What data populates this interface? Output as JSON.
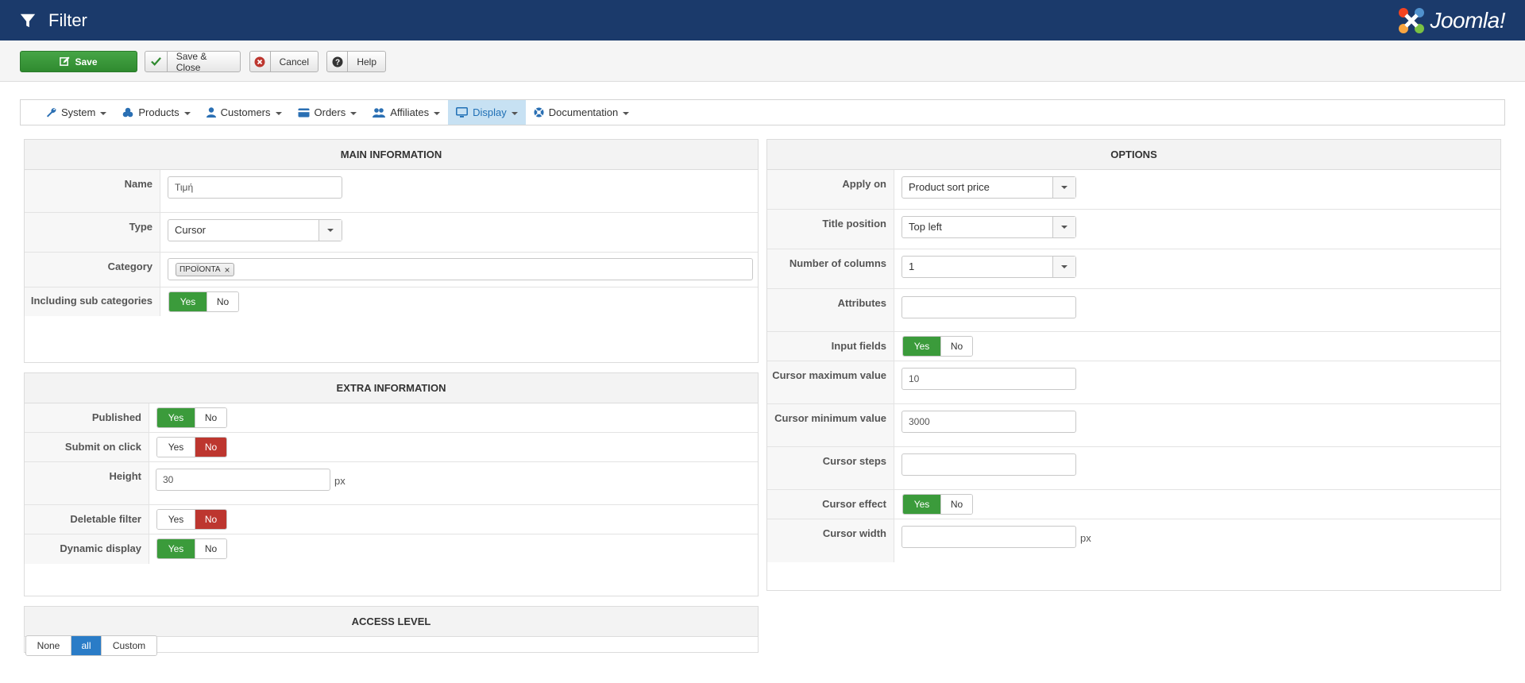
{
  "header": {
    "title": "Filter",
    "logo_text": "Joomla!"
  },
  "toolbar": {
    "save": "Save",
    "save_close": "Save & Close",
    "cancel": "Cancel",
    "help": "Help"
  },
  "menu": {
    "items": [
      {
        "label": "System",
        "icon": "wrench-icon"
      },
      {
        "label": "Products",
        "icon": "cubes-icon"
      },
      {
        "label": "Customers",
        "icon": "user-icon"
      },
      {
        "label": "Orders",
        "icon": "credit-card-icon"
      },
      {
        "label": "Affiliates",
        "icon": "users-icon"
      },
      {
        "label": "Display",
        "icon": "monitor-icon",
        "active": true
      },
      {
        "label": "Documentation",
        "icon": "lifebuoy-icon"
      }
    ]
  },
  "main_info": {
    "heading": "MAIN INFORMATION",
    "name_label": "Name",
    "name_value": "Τιμή",
    "type_label": "Type",
    "type_value": "Cursor",
    "category_label": "Category",
    "category_tag": "ΠΡΟΪΟΝΤΑ",
    "sub_label": "Including sub categories",
    "yes": "Yes",
    "no": "No",
    "sub_value": "Yes"
  },
  "extra_info": {
    "heading": "EXTRA INFORMATION",
    "published_label": "Published",
    "published_value": "Yes",
    "submit_label": "Submit on click",
    "submit_value": "No",
    "height_label": "Height",
    "height_value": "30",
    "height_unit": "px",
    "deletable_label": "Deletable filter",
    "deletable_value": "No",
    "dynamic_label": "Dynamic display",
    "dynamic_value": "Yes",
    "yes": "Yes",
    "no": "No"
  },
  "access": {
    "heading": "ACCESS LEVEL",
    "options": [
      "None",
      "all",
      "Custom"
    ],
    "selected": "all"
  },
  "options": {
    "heading": "OPTIONS",
    "apply_label": "Apply on",
    "apply_value": "Product sort price",
    "title_pos_label": "Title position",
    "title_pos_value": "Top left",
    "columns_label": "Number of columns",
    "columns_value": "1",
    "attributes_label": "Attributes",
    "attributes_value": "",
    "input_fields_label": "Input fields",
    "input_fields_value": "Yes",
    "max_label": "Cursor maximum value",
    "max_value": "10",
    "min_label": "Cursor minimum value",
    "min_value": "3000",
    "steps_label": "Cursor steps",
    "steps_value": "",
    "effect_label": "Cursor effect",
    "effect_value": "Yes",
    "width_label": "Cursor width",
    "width_value": "",
    "width_unit": "px",
    "yes": "Yes",
    "no": "No"
  },
  "colors": {
    "header_bg": "#1b3a6b",
    "save_green": "#3b9b3b",
    "no_red": "#bd362f",
    "active_blue": "#2a7cc7"
  }
}
